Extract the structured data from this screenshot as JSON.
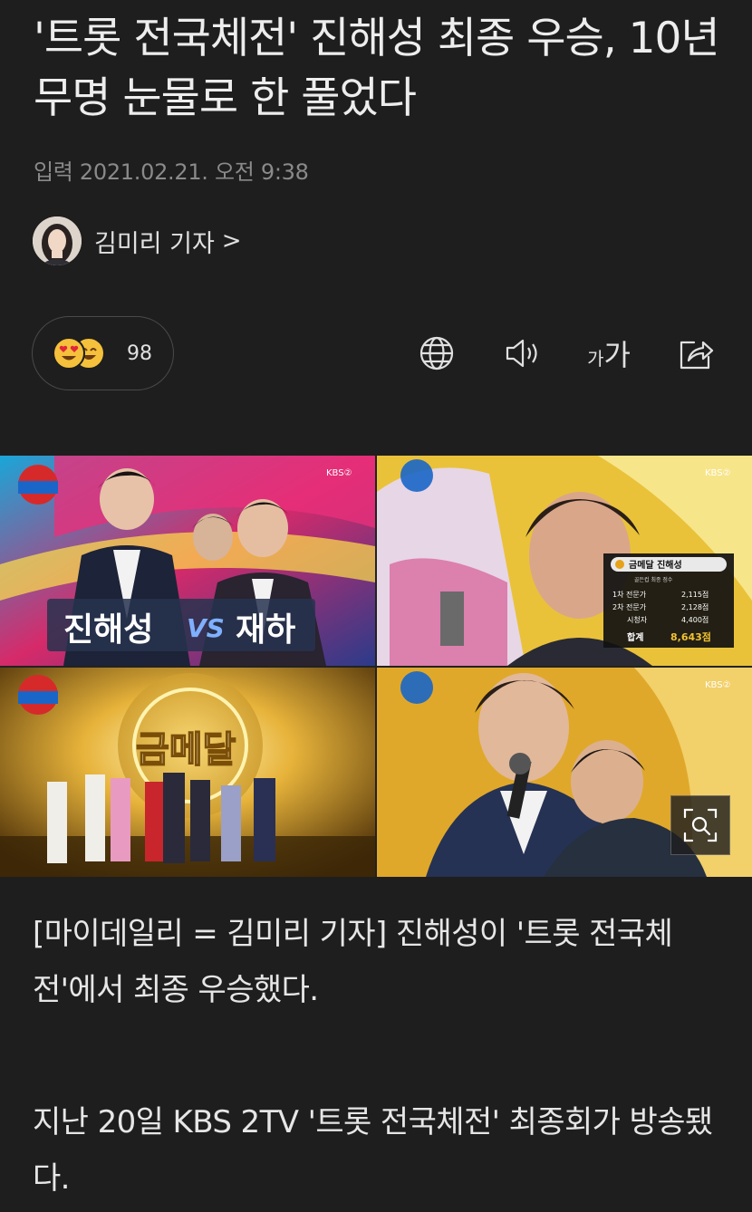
{
  "article": {
    "headline": "'트롯 전국체전' 진해성 최종 우승, 10년 무명 눈물로 한 풀었다",
    "dateline": "입력 2021.02.21. 오전 9:38",
    "reporter": {
      "name": "김미리 기자",
      "chevron": ">"
    },
    "reactions": {
      "count": "98",
      "icons": [
        "heart-eyes-emoji",
        "laughing-emoji"
      ]
    },
    "toolbar": {
      "translate_icon": "globe-icon",
      "listen_icon": "speaker-icon",
      "font_size_small": "가",
      "font_size_large": "가",
      "share_icon": "share-icon"
    },
    "photo": {
      "name_left": "진해성",
      "vs": "VS",
      "name_right": "재하",
      "gold_medal_text": "금메달",
      "score_board": {
        "title": "금메달 진해성",
        "subtitle": "골든컵 최종 점수",
        "rows": [
          {
            "label": "1차 전문가",
            "value": "2,115점"
          },
          {
            "label": "2차 전문가",
            "value": "2,128점"
          },
          {
            "label": "시청자",
            "value": "4,400점"
          }
        ],
        "total_label": "합계",
        "total_value": "8,643점"
      },
      "channel_mark": "KBS②"
    },
    "paragraphs": [
      "[마이데일리 = 김미리 기자] 진해성이 '트롯 전국체전'에서 최종 우승했다.",
      "지난 20일 KBS 2TV '트롯 전국체전' 최종회가 방송됐다."
    ]
  },
  "colors": {
    "background": "#1e1e1e",
    "text": "#e8e8e8",
    "muted": "#8a8a8a",
    "emoji": "#f5c03b"
  }
}
